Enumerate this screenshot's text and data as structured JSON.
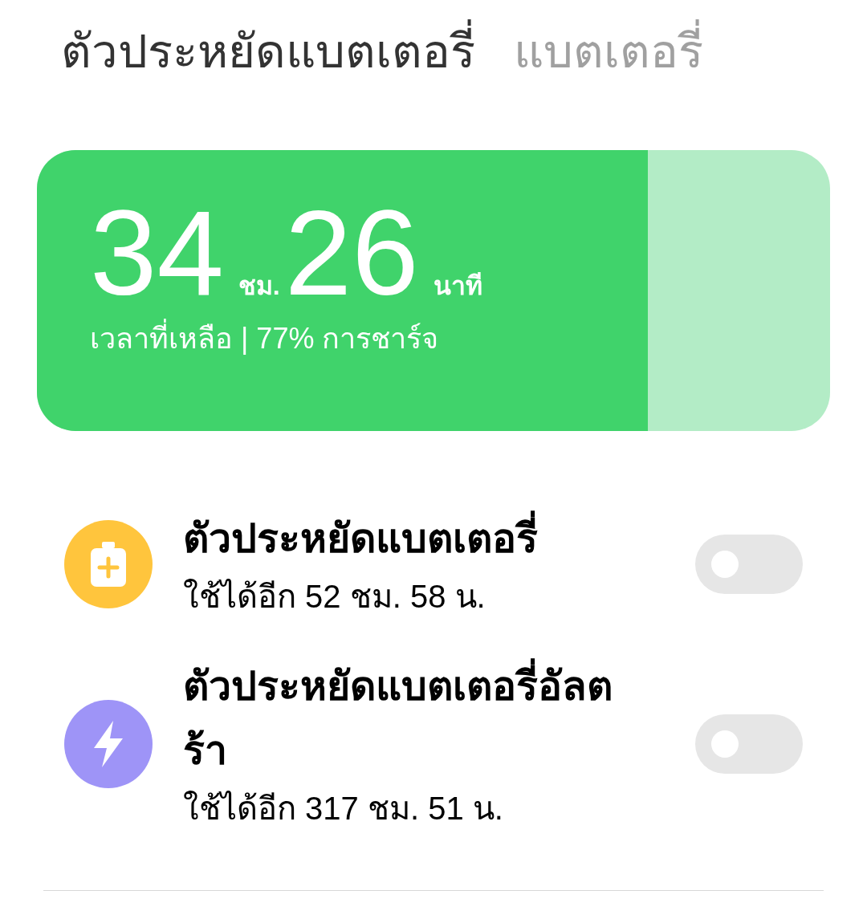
{
  "tabs": [
    {
      "label": "ตัวประหยัดแบตเตอรี่",
      "selected": true
    },
    {
      "label": "แบตเตอรี่",
      "selected": false
    }
  ],
  "battery": {
    "hours": "34",
    "hours_unit": "ชม.",
    "minutes": "26",
    "minutes_unit": "นาที",
    "caption": "เวลาที่เหลือ | 77% การชาร์จ",
    "level": 0.77
  },
  "modes": [
    {
      "kind": "saver",
      "color": "#ffc53d",
      "title": "ตัวประหยัดแบตเตอรี่",
      "subtitle": "ใช้ได้อีก 52 ชม. 58 น.",
      "on": false
    },
    {
      "kind": "ultra",
      "color": "#9e94f7",
      "title": "ตัวประหยัดแบตเตอรี่อัลตร้า",
      "subtitle": "ใช้ได้อีก 317 ชม. 51 น.",
      "on": false
    }
  ]
}
